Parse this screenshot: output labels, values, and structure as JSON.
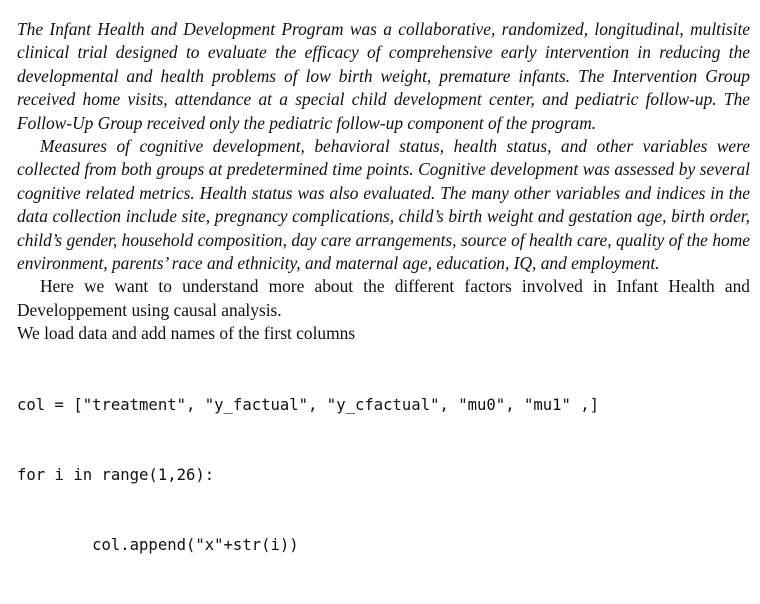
{
  "document": {
    "paragraphs": [
      "The Infant Health and Development Program was a collaborative, randomized, longitudinal, multisite clinical trial designed to evaluate the efficacy of comprehensive early intervention in reducing the developmental and health problems of low birth weight, premature infants. The Intervention Group received home visits, attendance at a special child development center, and pediatric follow-up. The Follow-Up Group received only the pediatric follow-up component of the program.",
      "Measures of cognitive development, behavioral status, health status, and other variables were collected from both groups at predetermined time points. Cognitive development was assessed by several cognitive related metrics. Health status was also evaluated. The many other variables and indices in the data collection include site, pregnancy complications, child’s birth weight and gestation age, birth order, child’s gender, household composition, day care arrangements, source of health care, quality of the home environment, parents’ race and ethnicity, and maternal age, education, IQ, and employment.",
      "Here we want to understand more about the different factors involved in Infant Health and Developpement using causal analysis."
    ],
    "load_line": "We load data and add names of the first columns",
    "code_lines": [
      "col = [\"treatment\", \"y_factual\", \"y_cfactual\", \"mu0\", \"mu1\" ,]",
      "for i in range(1,26):",
      "        col.append(\"x\"+str(i))"
    ]
  }
}
